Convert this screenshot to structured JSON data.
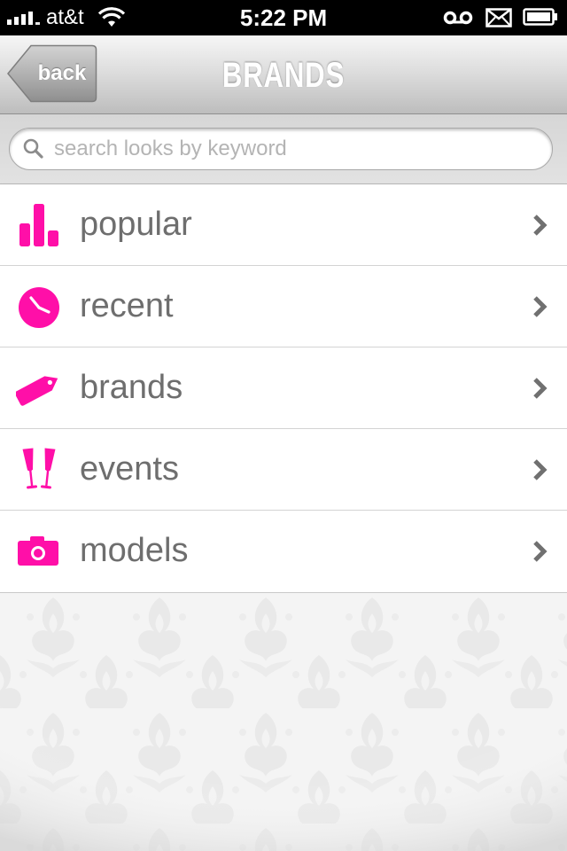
{
  "status_bar": {
    "carrier": "at&t",
    "time": "5:22 PM",
    "icons": [
      "signal-icon",
      "wifi-icon",
      "voicemail-icon",
      "mail-icon",
      "battery-icon"
    ]
  },
  "nav": {
    "back_label": "back",
    "title": "BRANDS"
  },
  "search": {
    "placeholder": "search looks by keyword",
    "value": ""
  },
  "menu": {
    "items": [
      {
        "label": "popular",
        "icon": "bar-chart-icon"
      },
      {
        "label": "recent",
        "icon": "clock-icon"
      },
      {
        "label": "brands",
        "icon": "tag-icon"
      },
      {
        "label": "events",
        "icon": "champagne-glasses-icon"
      },
      {
        "label": "models",
        "icon": "camera-icon"
      }
    ]
  },
  "colors": {
    "accent": "#ff0fa8",
    "label": "#6e6e6e",
    "chevron": "#707070"
  }
}
